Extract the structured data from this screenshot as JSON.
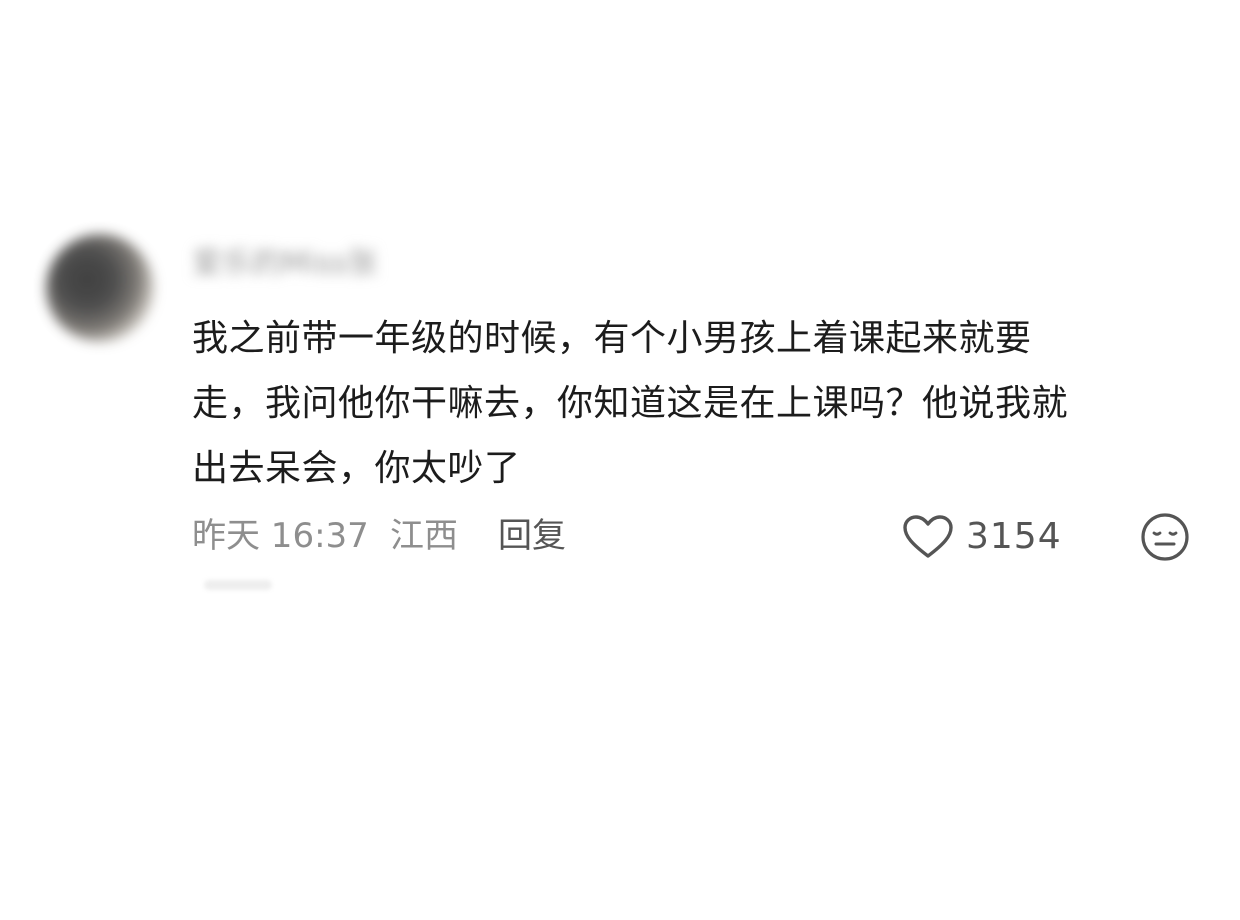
{
  "comment": {
    "username": "爱乐的Miss张",
    "text_lines": [
      "我之前带一年级的时候，有个小男孩上着课起来就要",
      "走，我问他你干嘛去，你知道这是在上课吗？他说我就",
      "出去呆会，你太吵了"
    ],
    "time": "昨天 16:37",
    "location": "江西",
    "reply_label": "回复",
    "like_count": "3154",
    "like_icon": "heart-outline-icon",
    "dislike_icon": "meh-face-icon"
  },
  "colors": {
    "text_primary": "#1c1c1c",
    "text_secondary": "#8e8e8e",
    "icon": "#555555",
    "background": "#ffffff"
  }
}
